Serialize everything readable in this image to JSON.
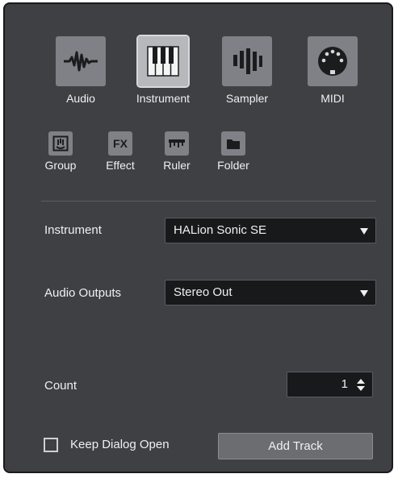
{
  "track_types": [
    {
      "label": "Audio",
      "icon": "waveform-icon",
      "selected": false
    },
    {
      "label": "Instrument",
      "icon": "piano-keys-icon",
      "selected": true
    },
    {
      "label": "Sampler",
      "icon": "sampler-bars-icon",
      "selected": false
    },
    {
      "label": "MIDI",
      "icon": "midi-connector-icon",
      "selected": false
    }
  ],
  "secondary_types": [
    {
      "label": "Group",
      "icon": "group-icon"
    },
    {
      "label": "Effect",
      "icon": "fx-icon"
    },
    {
      "label": "Ruler",
      "icon": "ruler-icon"
    },
    {
      "label": "Folder",
      "icon": "folder-icon"
    }
  ],
  "icon_text": {
    "fx": "FX"
  },
  "instrument": {
    "label": "Instrument",
    "value": "HALion Sonic SE"
  },
  "audio_outputs": {
    "label": "Audio Outputs",
    "value": "Stereo Out"
  },
  "count": {
    "label": "Count",
    "value": "1"
  },
  "keep_dialog_open": {
    "label": "Keep Dialog Open",
    "checked": false
  },
  "add_track": {
    "label": "Add Track"
  },
  "colors": {
    "dialog_bg": "#3f4044",
    "icon_bg": "#7f8186",
    "icon_selected_bg": "#b7b8bb",
    "field_bg": "#18191b",
    "button_bg": "#6c6d71"
  }
}
